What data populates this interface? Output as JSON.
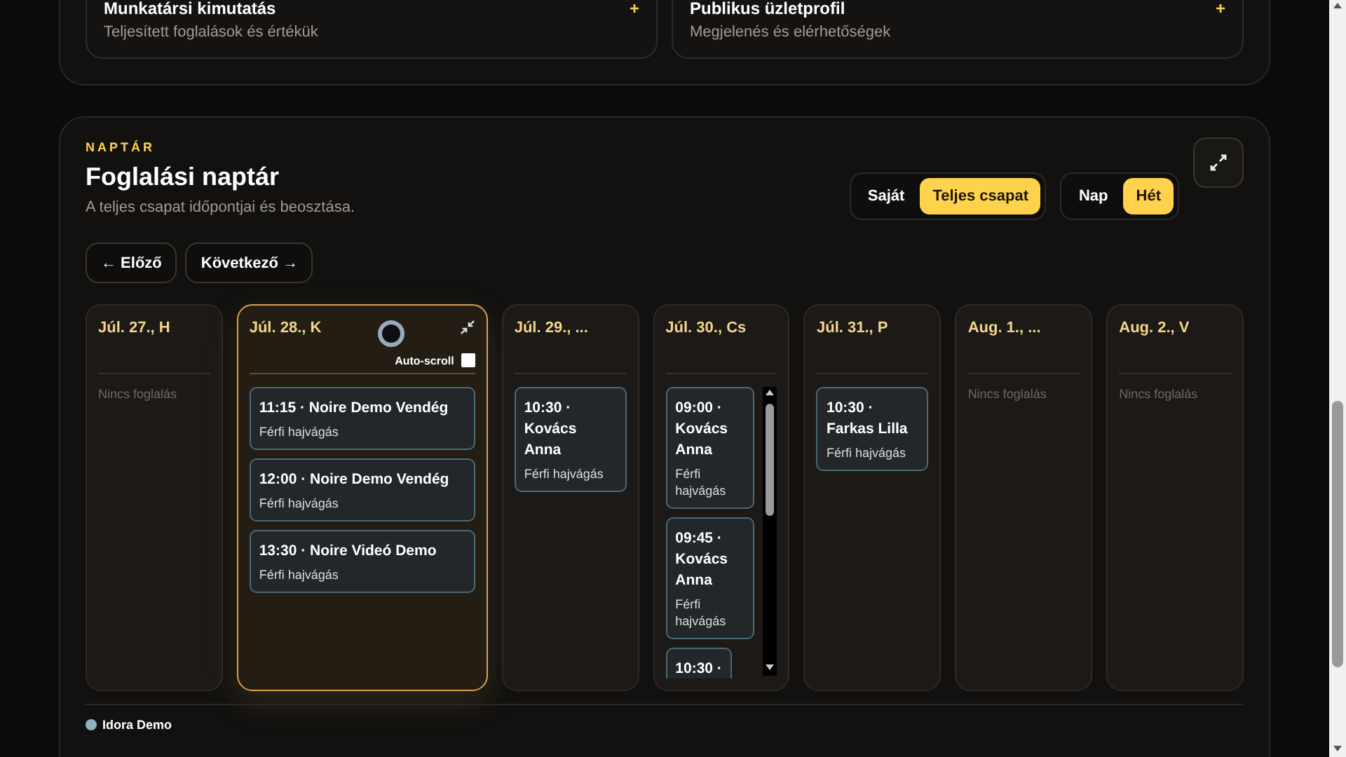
{
  "top_cards": [
    {
      "title": "Munkatársi kimutatás",
      "subtitle": "Teljesített foglalások és értékük",
      "action": "+"
    },
    {
      "title": "Publikus üzletprofil",
      "subtitle": "Megjelenés és elérhetőségek",
      "action": "+"
    }
  ],
  "calendar": {
    "eyebrow": "NAPTÁR",
    "title": "Foglalási naptár",
    "subtitle": "A teljes csapat időpontjai és beosztása.",
    "toggle_groups": [
      [
        {
          "label": "Saját",
          "selected": false
        },
        {
          "label": "Teljes csapat",
          "selected": true
        }
      ],
      [
        {
          "label": "Nap",
          "selected": false
        },
        {
          "label": "Hét",
          "selected": true
        }
      ]
    ],
    "nav": [
      "← Előző",
      "Következő →"
    ],
    "days": [
      {
        "label": "Júl. 27., H",
        "expanded": false,
        "empty": "Nincs foglalás"
      },
      {
        "label": "Júl. 28., K",
        "expanded": true,
        "autoscroll": {
          "label": "Auto-scroll",
          "checked": false
        },
        "bookings": [
          {
            "title": "11:15 · Noire Demo Vendég",
            "service": "Férfi hajvágás"
          },
          {
            "title": "12:00 · Noire Demo Vendég",
            "service": "Férfi hajvágás"
          },
          {
            "title": "13:30 · Noire Videó Demo",
            "service": "Férfi hajvágás"
          }
        ]
      },
      {
        "label": "Júl. 29., ...",
        "expanded": false,
        "bookings": [
          {
            "title": "10:30 · Kovács Anna",
            "service": "Férfi hajvágás"
          }
        ]
      },
      {
        "label": "Júl. 30., Cs",
        "expanded": false,
        "scrolls": true,
        "bookings": [
          {
            "title": "09:00 · Kovács Anna",
            "service": "Férfi hajvágás"
          },
          {
            "title": "09:45 · Kovács Anna",
            "service": "Férfi hajvágás"
          },
          {
            "title": "10:30 ·"
          }
        ]
      },
      {
        "label": "Júl. 31., P",
        "expanded": false,
        "bookings": [
          {
            "title": "10:30 · Farkas Lilla",
            "service": "Férfi hajvágás"
          }
        ]
      },
      {
        "label": "Aug. 1., ...",
        "expanded": false,
        "empty": "Nincs foglalás"
      },
      {
        "label": "Aug. 2., V",
        "expanded": false,
        "empty": "Nincs foglalás"
      }
    ],
    "legend": [
      {
        "label": "Idora Demo",
        "color": "#8fb3c0"
      }
    ]
  }
}
